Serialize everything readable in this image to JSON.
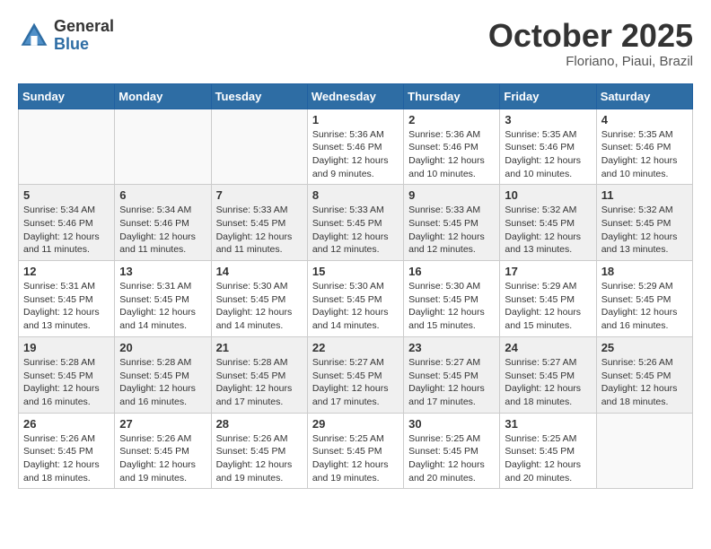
{
  "header": {
    "logo_general": "General",
    "logo_blue": "Blue",
    "month": "October 2025",
    "location": "Floriano, Piaui, Brazil"
  },
  "weekdays": [
    "Sunday",
    "Monday",
    "Tuesday",
    "Wednesday",
    "Thursday",
    "Friday",
    "Saturday"
  ],
  "weeks": [
    {
      "shaded": false,
      "days": [
        {
          "num": "",
          "info": ""
        },
        {
          "num": "",
          "info": ""
        },
        {
          "num": "",
          "info": ""
        },
        {
          "num": "1",
          "info": "Sunrise: 5:36 AM\nSunset: 5:46 PM\nDaylight: 12 hours\nand 9 minutes."
        },
        {
          "num": "2",
          "info": "Sunrise: 5:36 AM\nSunset: 5:46 PM\nDaylight: 12 hours\nand 10 minutes."
        },
        {
          "num": "3",
          "info": "Sunrise: 5:35 AM\nSunset: 5:46 PM\nDaylight: 12 hours\nand 10 minutes."
        },
        {
          "num": "4",
          "info": "Sunrise: 5:35 AM\nSunset: 5:46 PM\nDaylight: 12 hours\nand 10 minutes."
        }
      ]
    },
    {
      "shaded": true,
      "days": [
        {
          "num": "5",
          "info": "Sunrise: 5:34 AM\nSunset: 5:46 PM\nDaylight: 12 hours\nand 11 minutes."
        },
        {
          "num": "6",
          "info": "Sunrise: 5:34 AM\nSunset: 5:46 PM\nDaylight: 12 hours\nand 11 minutes."
        },
        {
          "num": "7",
          "info": "Sunrise: 5:33 AM\nSunset: 5:45 PM\nDaylight: 12 hours\nand 11 minutes."
        },
        {
          "num": "8",
          "info": "Sunrise: 5:33 AM\nSunset: 5:45 PM\nDaylight: 12 hours\nand 12 minutes."
        },
        {
          "num": "9",
          "info": "Sunrise: 5:33 AM\nSunset: 5:45 PM\nDaylight: 12 hours\nand 12 minutes."
        },
        {
          "num": "10",
          "info": "Sunrise: 5:32 AM\nSunset: 5:45 PM\nDaylight: 12 hours\nand 13 minutes."
        },
        {
          "num": "11",
          "info": "Sunrise: 5:32 AM\nSunset: 5:45 PM\nDaylight: 12 hours\nand 13 minutes."
        }
      ]
    },
    {
      "shaded": false,
      "days": [
        {
          "num": "12",
          "info": "Sunrise: 5:31 AM\nSunset: 5:45 PM\nDaylight: 12 hours\nand 13 minutes."
        },
        {
          "num": "13",
          "info": "Sunrise: 5:31 AM\nSunset: 5:45 PM\nDaylight: 12 hours\nand 14 minutes."
        },
        {
          "num": "14",
          "info": "Sunrise: 5:30 AM\nSunset: 5:45 PM\nDaylight: 12 hours\nand 14 minutes."
        },
        {
          "num": "15",
          "info": "Sunrise: 5:30 AM\nSunset: 5:45 PM\nDaylight: 12 hours\nand 14 minutes."
        },
        {
          "num": "16",
          "info": "Sunrise: 5:30 AM\nSunset: 5:45 PM\nDaylight: 12 hours\nand 15 minutes."
        },
        {
          "num": "17",
          "info": "Sunrise: 5:29 AM\nSunset: 5:45 PM\nDaylight: 12 hours\nand 15 minutes."
        },
        {
          "num": "18",
          "info": "Sunrise: 5:29 AM\nSunset: 5:45 PM\nDaylight: 12 hours\nand 16 minutes."
        }
      ]
    },
    {
      "shaded": true,
      "days": [
        {
          "num": "19",
          "info": "Sunrise: 5:28 AM\nSunset: 5:45 PM\nDaylight: 12 hours\nand 16 minutes."
        },
        {
          "num": "20",
          "info": "Sunrise: 5:28 AM\nSunset: 5:45 PM\nDaylight: 12 hours\nand 16 minutes."
        },
        {
          "num": "21",
          "info": "Sunrise: 5:28 AM\nSunset: 5:45 PM\nDaylight: 12 hours\nand 17 minutes."
        },
        {
          "num": "22",
          "info": "Sunrise: 5:27 AM\nSunset: 5:45 PM\nDaylight: 12 hours\nand 17 minutes."
        },
        {
          "num": "23",
          "info": "Sunrise: 5:27 AM\nSunset: 5:45 PM\nDaylight: 12 hours\nand 17 minutes."
        },
        {
          "num": "24",
          "info": "Sunrise: 5:27 AM\nSunset: 5:45 PM\nDaylight: 12 hours\nand 18 minutes."
        },
        {
          "num": "25",
          "info": "Sunrise: 5:26 AM\nSunset: 5:45 PM\nDaylight: 12 hours\nand 18 minutes."
        }
      ]
    },
    {
      "shaded": false,
      "days": [
        {
          "num": "26",
          "info": "Sunrise: 5:26 AM\nSunset: 5:45 PM\nDaylight: 12 hours\nand 18 minutes."
        },
        {
          "num": "27",
          "info": "Sunrise: 5:26 AM\nSunset: 5:45 PM\nDaylight: 12 hours\nand 19 minutes."
        },
        {
          "num": "28",
          "info": "Sunrise: 5:26 AM\nSunset: 5:45 PM\nDaylight: 12 hours\nand 19 minutes."
        },
        {
          "num": "29",
          "info": "Sunrise: 5:25 AM\nSunset: 5:45 PM\nDaylight: 12 hours\nand 19 minutes."
        },
        {
          "num": "30",
          "info": "Sunrise: 5:25 AM\nSunset: 5:45 PM\nDaylight: 12 hours\nand 20 minutes."
        },
        {
          "num": "31",
          "info": "Sunrise: 5:25 AM\nSunset: 5:45 PM\nDaylight: 12 hours\nand 20 minutes."
        },
        {
          "num": "",
          "info": ""
        }
      ]
    }
  ]
}
